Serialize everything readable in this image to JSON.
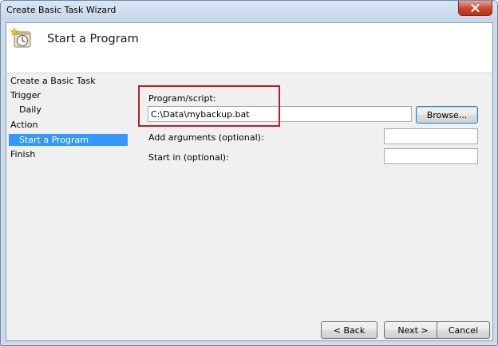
{
  "window": {
    "title": "Create Basic Task Wizard"
  },
  "header": {
    "title": "Start a Program"
  },
  "steps": [
    {
      "label": "Create a Basic Task"
    },
    {
      "label": "Trigger"
    },
    {
      "label": "Daily"
    },
    {
      "label": "Action"
    },
    {
      "label": "Start a Program"
    },
    {
      "label": "Finish"
    }
  ],
  "form": {
    "program_label": "Program/script:",
    "program_value": "C:\\Data\\mybackup.bat",
    "browse_label": "Browse...",
    "args_label": "Add arguments (optional):",
    "args_value": "",
    "startin_label": "Start in (optional):",
    "startin_value": ""
  },
  "footer": {
    "back_label": "< Back",
    "next_label": "Next >",
    "cancel_label": "Cancel"
  },
  "colors": {
    "selection": "#3399ff",
    "highlight_box": "#b3202a",
    "close_button": "#c9452d"
  }
}
